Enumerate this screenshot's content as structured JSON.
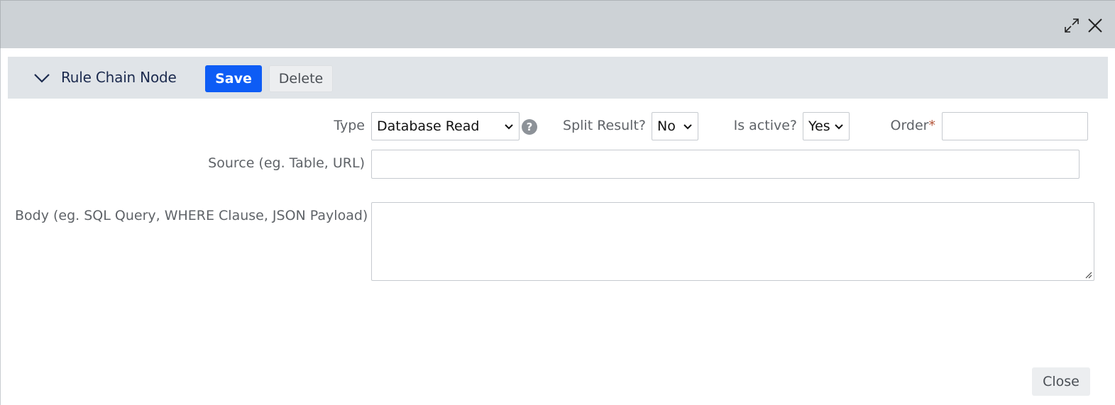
{
  "window": {
    "maximize_icon": "expand-arrows-icon",
    "close_icon": "close-x-icon"
  },
  "section": {
    "title": "Rule Chain Node",
    "collapse_icon": "chevron-down-icon",
    "save_label": "Save",
    "delete_label": "Delete"
  },
  "form": {
    "type_label": "Type",
    "type_value": "Database Read",
    "help_glyph": "?",
    "split_label": "Split Result?",
    "split_value": "No",
    "active_label": "Is active?",
    "active_value": "Yes",
    "order_label": "Order",
    "order_required": "*",
    "order_value": "",
    "source_label": "Source (eg. Table, URL)",
    "source_value": "",
    "body_label": "Body (eg. SQL Query, WHERE Clause, JSON Payload)",
    "body_value": ""
  },
  "footer": {
    "close_label": "Close"
  },
  "colors": {
    "primary": "#0d5cf5",
    "header_bg": "#e0e4e8",
    "titlebar_bg": "#cdd2d6",
    "title_text": "#1b2a4e"
  }
}
